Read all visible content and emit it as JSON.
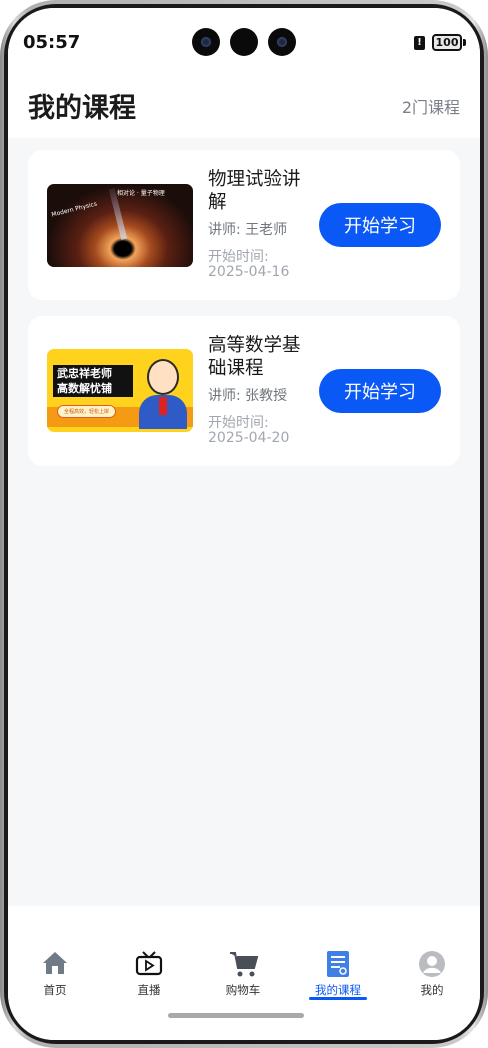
{
  "status_bar": {
    "time": "05:57",
    "battery": "100"
  },
  "header": {
    "title": "我的课程",
    "count": "2门课程"
  },
  "courses": [
    {
      "title": "物理试验讲解",
      "teacher": "讲师: 王老师",
      "start_label": "开始时间:",
      "start_date": "2025-04-16",
      "button": "开始学习",
      "thumb_text": [
        "相对论 · 量子物理",
        "Modern Physics"
      ]
    },
    {
      "title": "高等数学基础课程",
      "teacher": "讲师: 张教授",
      "start_label": "开始时间:",
      "start_date": "2025-04-20",
      "button": "开始学习",
      "thumb_text": [
        "武忠祥老师",
        "高数解忧铺",
        "全程高效，轻松上岸"
      ]
    }
  ],
  "tabs": [
    {
      "label": "首页",
      "icon": "home-icon"
    },
    {
      "label": "直播",
      "icon": "tv-icon"
    },
    {
      "label": "购物车",
      "icon": "cart-icon"
    },
    {
      "label": "我的课程",
      "icon": "document-icon",
      "active": true
    },
    {
      "label": "我的",
      "icon": "user-icon"
    }
  ],
  "colors": {
    "accent": "#0a59f7",
    "background": "#f6f7f9"
  }
}
